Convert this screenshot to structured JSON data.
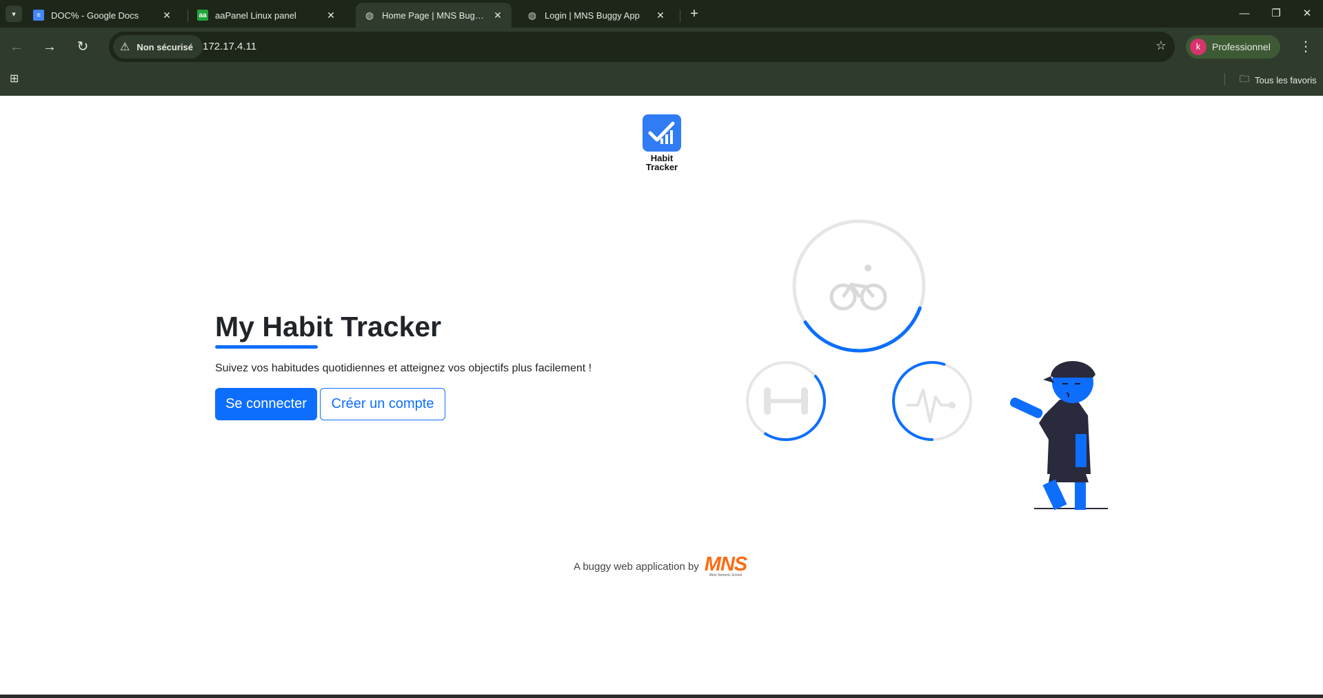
{
  "browser": {
    "tabs": [
      {
        "title": "DOC% - Google Docs",
        "icon": "google-docs-icon",
        "active": false
      },
      {
        "title": "aaPanel Linux panel",
        "icon": "aapanel-icon",
        "active": false
      },
      {
        "title": "Home Page | MNS Buggy App",
        "icon": "globe-icon",
        "active": true
      },
      {
        "title": "Login | MNS Buggy App",
        "icon": "globe-icon",
        "active": false
      }
    ],
    "security_label": "Non sécurisé",
    "url": "172.17.4.11",
    "profile": {
      "initial": "k",
      "label": "Professionnel"
    },
    "bookmarks_all_label": "Tous les favoris",
    "colors": {
      "frame": "#1d2619",
      "toolbar": "#2f3b2d",
      "profile_chip": "#3d5a34"
    }
  },
  "page": {
    "logo_text": [
      "Habit",
      "Tracker"
    ],
    "title": "My Habit Tracker",
    "subtitle": "Suivez vos habitudes quotidiennes et atteignez vos objectifs plus facilement !",
    "login_button": "Se connecter",
    "register_button": "Créer un compte",
    "footer_text": "A buggy web application by",
    "footer_brand": "MNS",
    "footer_brand_tagline": "Metz Numeric School",
    "colors": {
      "accent": "#0d6efd",
      "brand_orange": "#ff6a13",
      "text": "#212529"
    },
    "illustration": {
      "activities": [
        {
          "icon": "bicycle-icon",
          "progress": 0.35
        },
        {
          "icon": "dumbbell-icon",
          "progress": 0.45
        },
        {
          "icon": "heartbeat-icon",
          "progress": 0.55
        }
      ]
    }
  }
}
